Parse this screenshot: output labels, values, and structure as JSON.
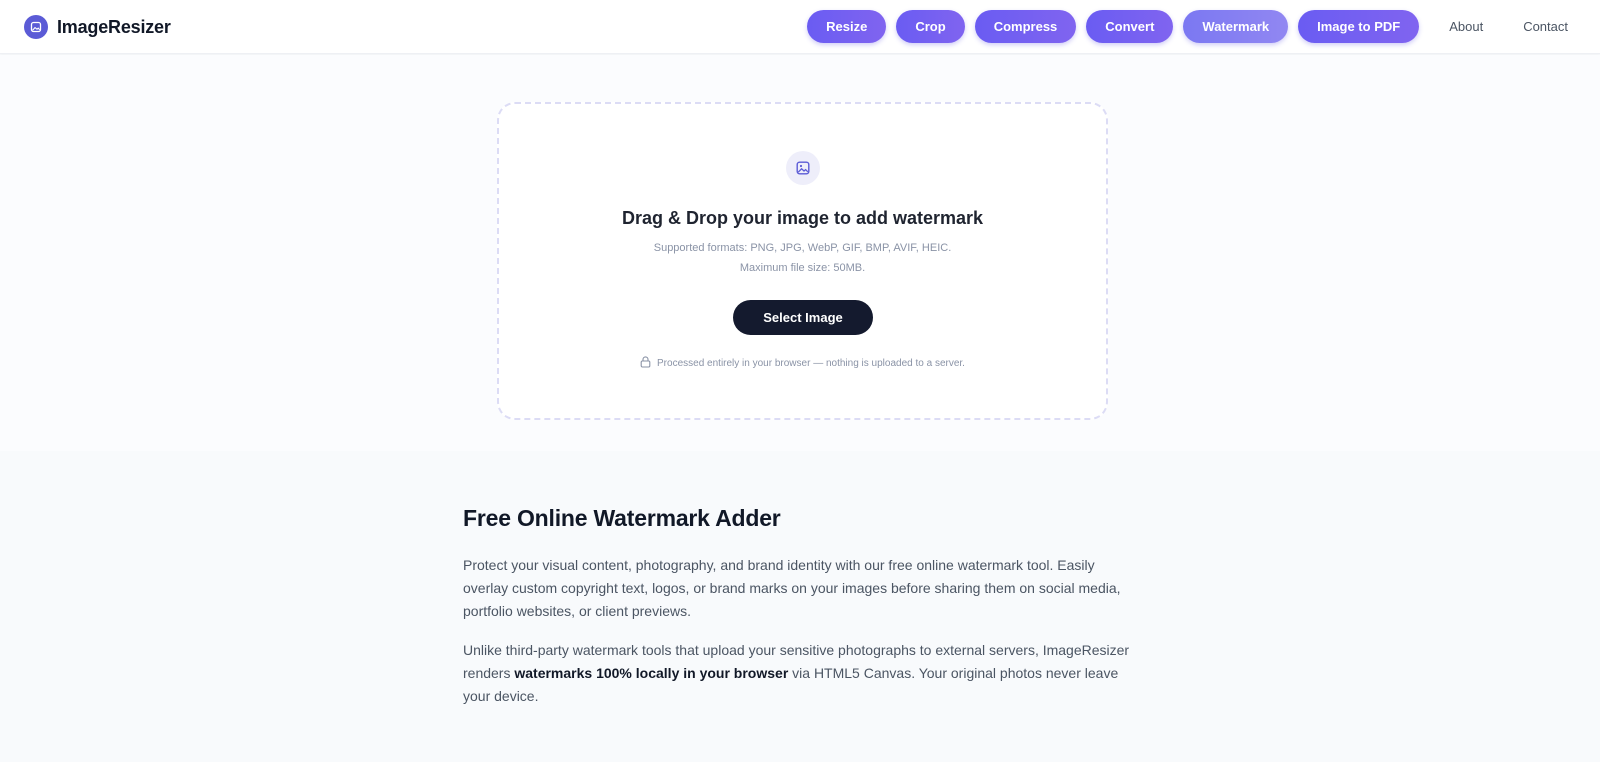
{
  "brand": {
    "name": "ImageResizer",
    "icon": "image-icon",
    "color": "#5b5bd6"
  },
  "nav": {
    "pills": [
      {
        "label": "Resize"
      },
      {
        "label": "Crop"
      },
      {
        "label": "Compress"
      },
      {
        "label": "Convert"
      },
      {
        "label": "Watermark",
        "active": true
      },
      {
        "label": "Image to PDF"
      }
    ],
    "links": [
      {
        "label": "About"
      },
      {
        "label": "Contact"
      }
    ],
    "accent": "#6a5cf2"
  },
  "upload": {
    "icon": "image-icon",
    "title": "Drag & Drop your image to add watermark",
    "formats": "Supported formats: PNG, JPG, WebP, GIF, BMP, AVIF, HEIC.",
    "max_size": "Maximum file size: 50MB.",
    "button": "Select Image",
    "privacy_icon": "lock-icon",
    "privacy": "Processed entirely in your browser — nothing is uploaded to a server."
  },
  "article": {
    "title": "Free Online Watermark Adder",
    "p1": "Protect your visual content, photography, and brand identity with our free online watermark tool. Easily overlay custom copyright text, logos, or brand marks on your images before sharing them on social media, portfolio websites, or client previews.",
    "p2_before": "Unlike third-party watermark tools that upload your sensitive photographs to external servers, ImageResizer renders ",
    "p2_bold": "watermarks 100% locally in your browser",
    "p2_after": " via HTML5 Canvas. Your original photos never leave your device."
  }
}
